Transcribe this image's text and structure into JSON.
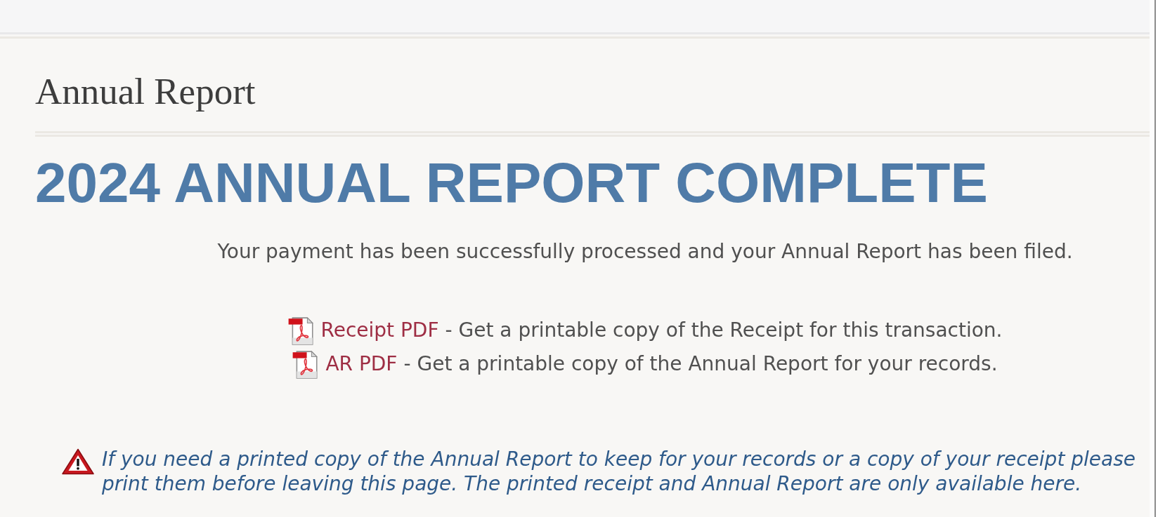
{
  "header": {
    "title": "Annual Report"
  },
  "headline": "2024 ANNUAL REPORT COMPLETE",
  "message": "Your payment has been successfully processed and your Annual Report has been filed.",
  "downloads": [
    {
      "link": "Receipt PDF",
      "description": "- Get a printable copy of the Receipt for this transaction."
    },
    {
      "link": "AR PDF",
      "description": "- Get a printable copy of the Annual Report for your records."
    }
  ],
  "notice": {
    "kind": "warning",
    "text": "If you need a printed copy of the Annual Report to keep for your records or a copy of your receipt please print them before leaving this page. The printed receipt and Annual Report are only available here."
  }
}
